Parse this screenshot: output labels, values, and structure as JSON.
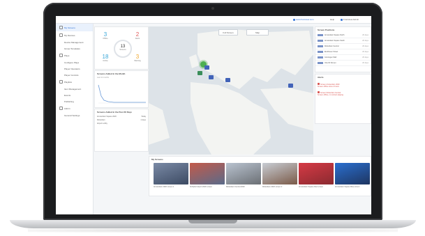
{
  "topbar": {
    "link": "www.frontview.com",
    "help": "Help",
    "user": "Frontview Admin"
  },
  "sidebar": {
    "items": [
      {
        "label": "My Screens",
        "active": true
      },
      {
        "label": "My Devices"
      },
      {
        "label": "Device Management",
        "sub": true
      },
      {
        "label": "Group Templates",
        "sub": true
      },
      {
        "label": "Plays"
      },
      {
        "label": "Configure Plays",
        "sub": true
      },
      {
        "label": "Player Operators",
        "sub": true
      },
      {
        "label": "Player Controls",
        "sub": true
      },
      {
        "label": "Playlists"
      },
      {
        "label": "Item Management",
        "sub": true
      },
      {
        "label": "Events",
        "sub": true
      },
      {
        "label": "Publishing",
        "sub": true
      },
      {
        "label": "Admin"
      },
      {
        "label": "General Settings",
        "sub": true
      }
    ]
  },
  "stats": {
    "center": {
      "value": "13",
      "label": "Screens"
    },
    "top_left": {
      "value": "3",
      "label": "Offline",
      "color": "#3aa7d8"
    },
    "top_right": {
      "value": "2",
      "label": "Alerts",
      "color": "#e05a5a"
    },
    "bottom_left": {
      "value": "18",
      "label": "Online",
      "color": "#3aa7d8"
    },
    "bottom_right": {
      "value": "3",
      "label": "Warning",
      "color": "#f0a830"
    }
  },
  "chart_card": {
    "title": "Screens Added in the Month",
    "subtitle": "Last 12 months"
  },
  "list_card": {
    "title": "Screens Added in the Past 30 Days",
    "rows": [
      {
        "name": "Amsterdam Square 2020",
        "value": "Today"
      },
      {
        "name": "Rotterdam",
        "value": "2 days"
      },
      {
        "name": "Airport Lobby",
        "value": ""
      }
    ]
  },
  "map": {
    "fullscreen_label": "Full Screen",
    "map_label": "Map"
  },
  "right_panel": {
    "title": "Screen Positions",
    "rows": [
      {
        "name": "Amsterdam Square North",
        "meta": "20 days"
      },
      {
        "name": "Amsterdam Square South",
        "meta": "20 days"
      },
      {
        "name": "Rotterdam Central",
        "meta": "20 days"
      },
      {
        "name": "Eindhoven Street",
        "meta": "20 days"
      },
      {
        "name": "Groningen Mall",
        "meta": "20 days"
      },
      {
        "name": "Utrecht Screen",
        "meta": "20 days"
      }
    ],
    "alerts_title": "Alerts",
    "alerts": [
      {
        "title": "Screen Amsterdam 2020",
        "desc": "Screen offline since 2 hours"
      },
      {
        "title": "Screen Rotterdam Central",
        "desc": "Screen offline, no content playing"
      }
    ]
  },
  "my_screens": {
    "title": "My Screens",
    "items": [
      {
        "caption": "Amsterdam 2020 screen 1",
        "color1": "#7a8aa6",
        "color2": "#3c4a62"
      },
      {
        "caption": "Schiphol Airport 2020 screen",
        "color1": "#c35a4a",
        "color2": "#5a6b8a"
      },
      {
        "caption": "Rotterdam Central 2020",
        "color1": "#b9c3d0",
        "color2": "#6b6f74"
      },
      {
        "caption": "Rotterdam 2020 screen 2",
        "color1": "#c8cdd4",
        "color2": "#7a5a48"
      },
      {
        "caption": "Amsterdam Square Red screen",
        "color1": "#d63a45",
        "color2": "#8a2a30"
      },
      {
        "caption": "Amsterdam Square Blue screen",
        "color1": "#2a6fd0",
        "color2": "#1e3560"
      },
      {
        "caption": "Amsterdam Square 2020",
        "color1": "#a0aab8",
        "color2": "#5a4a44"
      }
    ]
  }
}
